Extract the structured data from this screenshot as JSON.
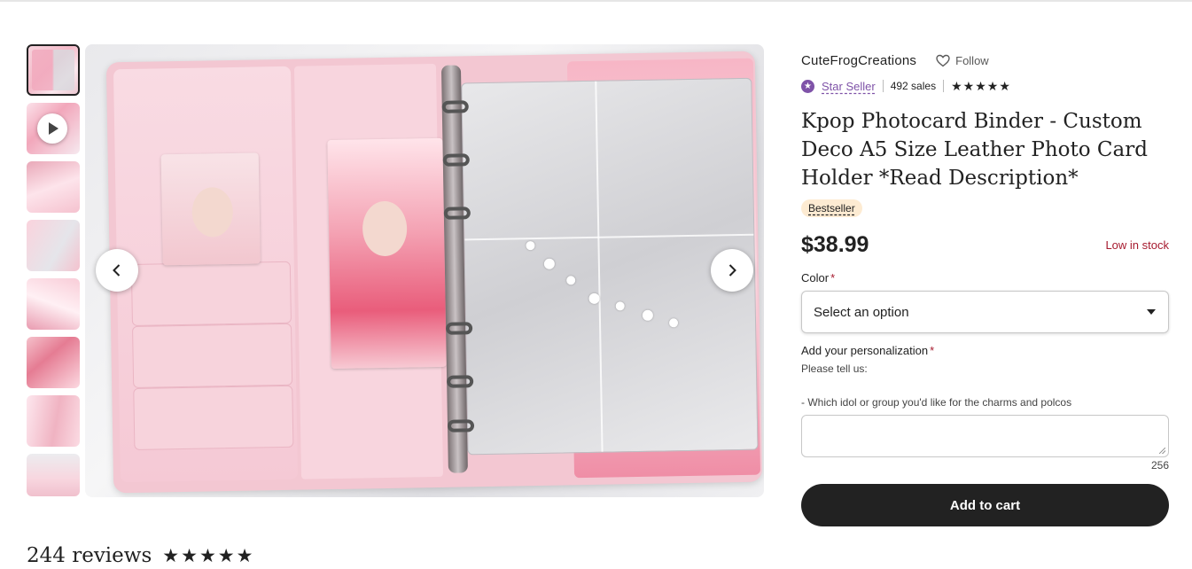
{
  "shop": {
    "name": "CuteFrogCreations",
    "follow_label": "Follow",
    "star_seller_label": "Star Seller",
    "sales": "492 sales",
    "rating_stars": 5
  },
  "listing": {
    "title": "Kpop Photocard Binder - Custom Deco A5 Size Leather Photo Card Holder *Read Description*",
    "badge": "Bestseller",
    "price": "$38.99",
    "stock_status": "Low in stock"
  },
  "color_field": {
    "label": "Color",
    "required_mark": "*",
    "selected": "Select an option"
  },
  "personalization": {
    "label": "Add your personalization",
    "required_mark": "*",
    "hint_line1": "Please tell us:",
    "hint_line2": "- Which idol or group you'd like for the charms and polcos",
    "char_count": "256"
  },
  "cart": {
    "button_label": "Add to cart"
  },
  "reviews": {
    "count_label": "244 reviews",
    "rating_stars": 5
  },
  "gallery": {
    "thumbnail_count": 8,
    "active_index": 0,
    "video_thumbnail_index": 1
  },
  "colors": {
    "star_seller": "#7f53a8",
    "low_stock": "#a61a2e",
    "badge_bg": "#fdebd2",
    "cart_button": "#222222"
  },
  "icons": {
    "follow": "heart-outline-icon",
    "star_seller": "star-seller-icon",
    "prev": "chevron-left-icon",
    "next": "chevron-right-icon",
    "dropdown": "caret-down-icon",
    "play": "play-icon"
  }
}
